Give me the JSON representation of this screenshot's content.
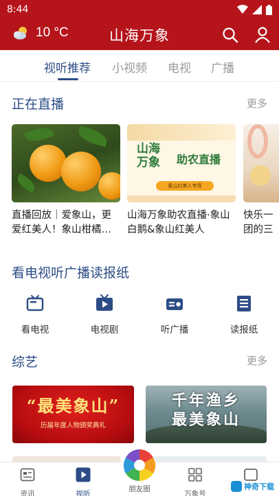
{
  "status_bar": {
    "time": "8:44"
  },
  "header": {
    "temperature": "10 °C",
    "title": "山海万象",
    "weather_icon": "partly-cloudy-icon",
    "search_icon": "search-icon",
    "user_icon": "user-icon"
  },
  "tabs": [
    {
      "label": "视听推荐",
      "active": true
    },
    {
      "label": "小视频",
      "active": false
    },
    {
      "label": "电视",
      "active": false
    },
    {
      "label": "广播",
      "active": false
    }
  ],
  "live_section": {
    "title": "正在直播",
    "more": "更多",
    "cards": [
      {
        "caption": "直播回放｜爱象山，更爱红美人！象山柑橘…"
      },
      {
        "caption": "山海万象助农直播·象山白鹅&象山红美人",
        "banner_line1": "山海",
        "banner_line2": "万象",
        "banner_right": "助农直播",
        "banner_pill": "象山红美人专场"
      },
      {
        "caption": "快乐一团的三"
      }
    ]
  },
  "media_section": {
    "title": "看电视听广播读报纸",
    "items": [
      {
        "label": "看电视",
        "icon": "tv-icon"
      },
      {
        "label": "电视剧",
        "icon": "tv-play-icon"
      },
      {
        "label": "听广播",
        "icon": "radio-icon"
      },
      {
        "label": "读报纸",
        "icon": "newspaper-icon"
      }
    ]
  },
  "variety_section": {
    "title": "综艺",
    "more": "更多",
    "cards": [
      {
        "title": "“最美象山”",
        "subtitle": "历届年度人物颁奖典礼"
      },
      {
        "title_line1": "千年渔乡",
        "title_line2": "最美象山"
      }
    ]
  },
  "bottom_nav": [
    {
      "label": "资讯",
      "icon": "news-icon",
      "active": false
    },
    {
      "label": "视听",
      "icon": "play-icon",
      "active": true
    },
    {
      "label": "朋友圈",
      "icon": "camera-aperture-icon",
      "active": false
    },
    {
      "label": "万象号",
      "icon": "grid-icon",
      "active": false
    },
    {
      "label": "",
      "icon": "more-icon",
      "active": false
    }
  ],
  "watermark": {
    "text": "神奇下载"
  },
  "colors": {
    "brand_red": "#b5141b",
    "accent_blue": "#2c4c86"
  }
}
